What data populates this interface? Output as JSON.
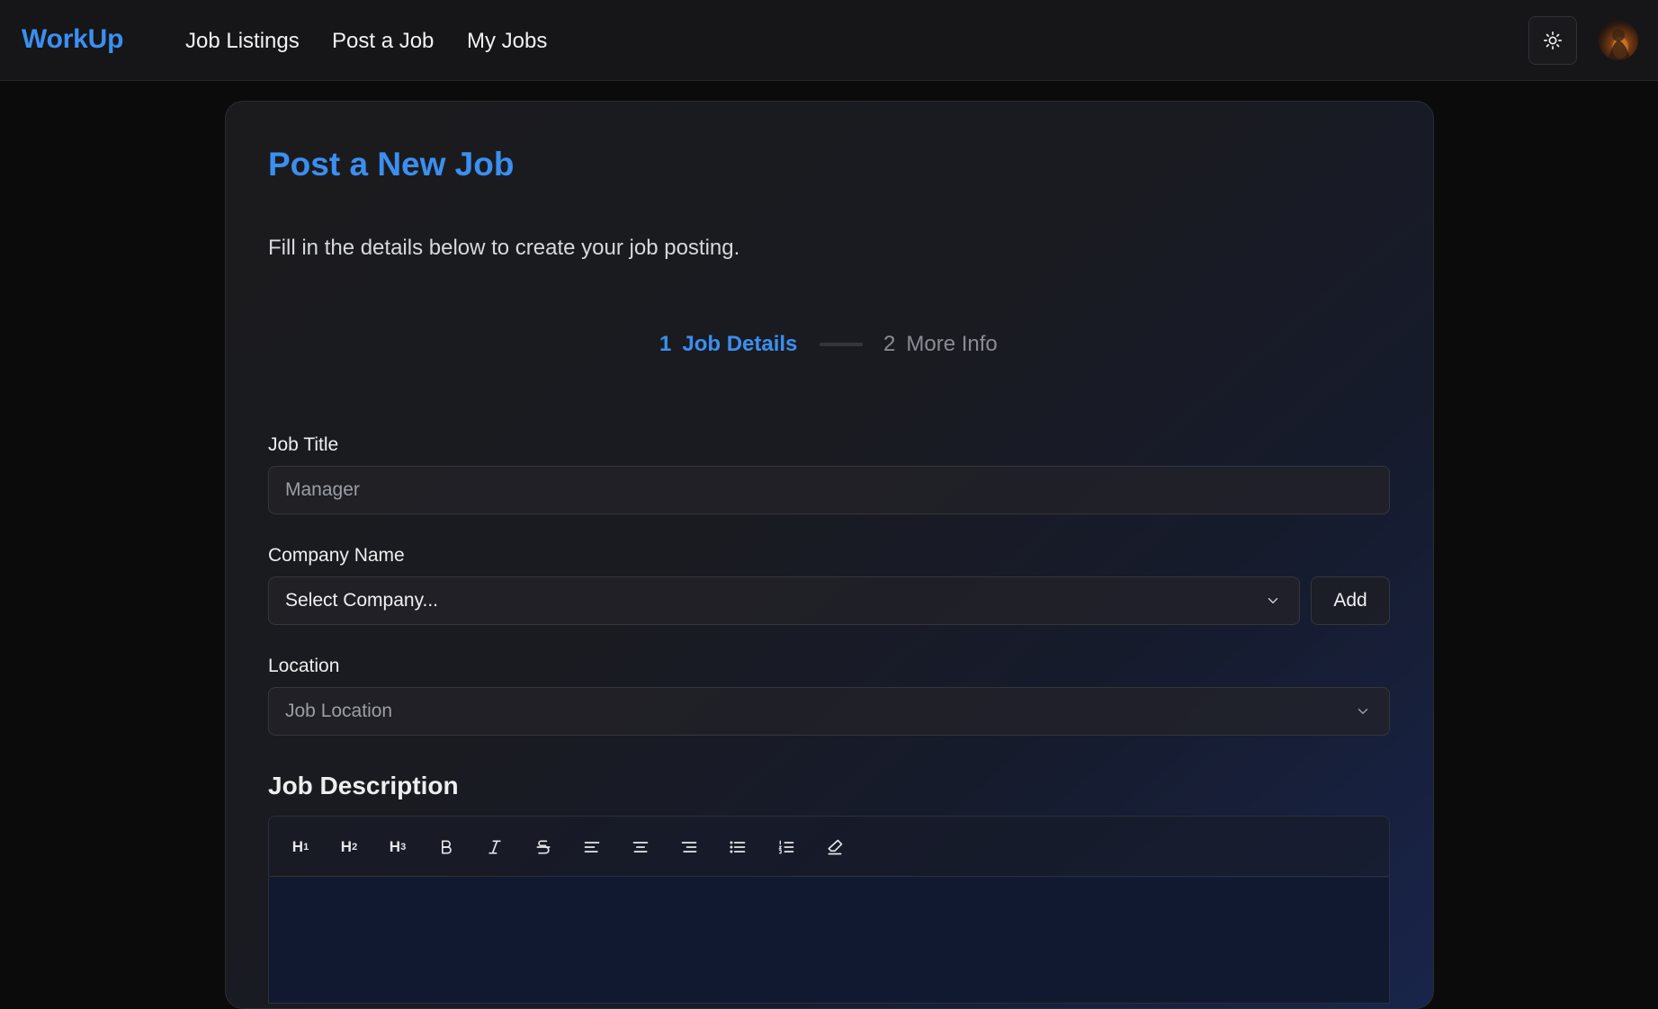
{
  "app": {
    "brand": "WorkUp",
    "nav": [
      "Job Listings",
      "Post a Job",
      "My Jobs"
    ],
    "theme_toggle_icon": "sun-icon",
    "accent_color": "#3b8ff0"
  },
  "page": {
    "title": "Post a New Job",
    "subtitle": "Fill in the details below to create your job posting."
  },
  "stepper": {
    "steps": [
      {
        "number": "1",
        "label": "Job Details",
        "active": true
      },
      {
        "number": "2",
        "label": "More Info",
        "active": false
      }
    ]
  },
  "form": {
    "job_title": {
      "label": "Job Title",
      "placeholder": "Manager",
      "value": ""
    },
    "company": {
      "label": "Company Name",
      "selected": "Select Company...",
      "add_label": "Add"
    },
    "location": {
      "label": "Location",
      "placeholder": "Job Location"
    },
    "description": {
      "heading": "Job Description",
      "toolbar": [
        "h1-icon",
        "h2-icon",
        "h3-icon",
        "bold-icon",
        "italic-icon",
        "strikethrough-icon",
        "align-left-icon",
        "align-center-icon",
        "align-right-icon",
        "bullet-list-icon",
        "ordered-list-icon",
        "clear-format-icon"
      ]
    }
  }
}
